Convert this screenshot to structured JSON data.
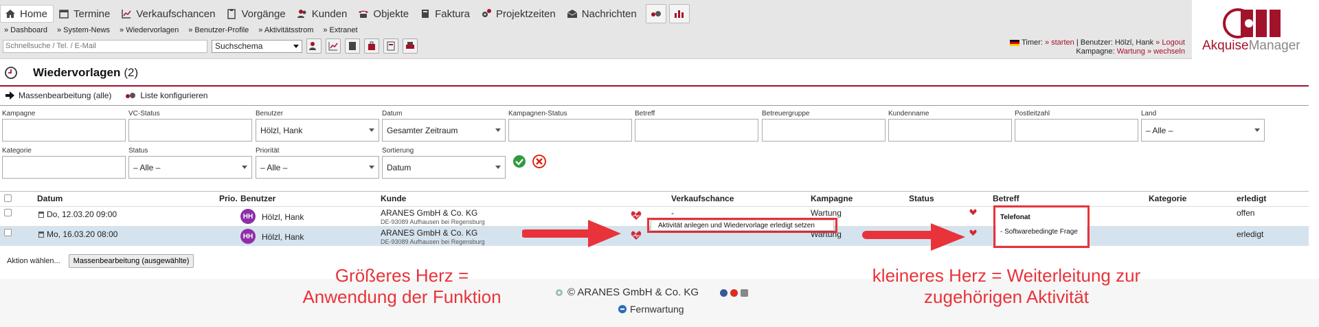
{
  "nav": {
    "items": [
      {
        "label": "Home",
        "icon": "home-icon",
        "active": true
      },
      {
        "label": "Termine",
        "icon": "calendar-icon"
      },
      {
        "label": "Verkaufschancen",
        "icon": "chart-line-icon"
      },
      {
        "label": "Vorgänge",
        "icon": "clipboard-icon"
      },
      {
        "label": "Kunden",
        "icon": "users-icon"
      },
      {
        "label": "Objekte",
        "icon": "phone-icon"
      },
      {
        "label": "Faktura",
        "icon": "book-icon"
      },
      {
        "label": "Projektzeiten",
        "icon": "gears-icon"
      },
      {
        "label": "Nachrichten",
        "icon": "envelope-icon"
      }
    ]
  },
  "subnav": [
    "» Dashboard",
    "» System-News",
    "» Wiedervorlagen",
    "» Benutzer-Profile",
    "» Aktivitätsstrom",
    "» Extranet"
  ],
  "search": {
    "placeholder": "Schnellsuche / Tel. / E-Mail",
    "schema": "Suchschema"
  },
  "userinfo": {
    "timer_label": "Timer:",
    "timer_link": "» starten",
    "benutzer": "| Benutzer: Hölzl, Hank",
    "logout": "» Logout",
    "kampagne_label": "Kampagne:",
    "kampagne_value": "Wartung",
    "wechseln": "» wechseln"
  },
  "brand": {
    "part1": "Akquise",
    "part2": "Manager"
  },
  "page": {
    "title": "Wiedervorlagen",
    "count": "(2)"
  },
  "actions": {
    "bulk_all": "Massenbearbeitung (alle)",
    "configure": "Liste konfigurieren"
  },
  "filters": {
    "row1": [
      {
        "label": "Kampagne",
        "value": ""
      },
      {
        "label": "VC-Status",
        "value": ""
      },
      {
        "label": "Benutzer",
        "value": "Hölzl, Hank"
      },
      {
        "label": "Datum",
        "value": "Gesamter Zeitraum"
      },
      {
        "label": "Kampagnen-Status",
        "value": ""
      },
      {
        "label": "Betreff",
        "value": ""
      },
      {
        "label": "Betreuergruppe",
        "value": ""
      },
      {
        "label": "Kundenname",
        "value": ""
      },
      {
        "label": "Postleitzahl",
        "value": ""
      },
      {
        "label": "Land",
        "value": "– Alle –"
      }
    ],
    "row2": [
      {
        "label": "Kategorie",
        "value": ""
      },
      {
        "label": "Status",
        "value": "– Alle –"
      },
      {
        "label": "Priorität",
        "value": "– Alle –"
      },
      {
        "label": "Sortierung",
        "value": "Datum"
      }
    ]
  },
  "table": {
    "headers": {
      "datum": "Datum",
      "prio": "Prio.",
      "benutzer": "Benutzer",
      "kunde": "Kunde",
      "verkaufschance": "Verkaufschance",
      "kampagne": "Kampagne",
      "status": "Status",
      "betreff": "Betreff",
      "kategorie": "Kategorie",
      "erledigt": "erledigt"
    },
    "rows": [
      {
        "datum": "Do, 12.03.20 09:00",
        "avatar": "HH",
        "benutzer": "Hölzl, Hank",
        "kunde": "ARANES GmbH & Co. KG",
        "kunde_sub": "DE-93089 Aufhausen bei Regensburg",
        "verkaufschance": "-",
        "kampagne": "Wartung",
        "erledigt": "offen"
      },
      {
        "datum": "Mo, 16.03.20 08:00",
        "avatar": "HH",
        "benutzer": "Hölzl, Hank",
        "kunde": "ARANES GmbH & Co. KG",
        "kunde_sub": "DE-93089 Aufhausen bei Regensburg",
        "verkaufschance": "",
        "kampagne": "Wartung",
        "erledigt": "erledigt"
      }
    ]
  },
  "tooltip1": "Aktivität anlegen und Wiedervorlage erledigt setzen",
  "tooltip2": {
    "title": "Telefonat",
    "body": "- Softwarebedingte Frage"
  },
  "bulk": {
    "label": "Aktion wählen...",
    "button": "Massenbearbeitung (ausgewählte)"
  },
  "annotations": {
    "left_line1": "Größeres Herz =",
    "left_line2": "Anwendung der Funktion",
    "right_line1": "kleineres Herz = Weiterleitung zur",
    "right_line2": "zugehörigen Aktivität"
  },
  "footer": {
    "copyright": "© ARANES GmbH & Co. KG",
    "fernwartung": "Fernwartung"
  },
  "colors": {
    "accent": "#a3122b",
    "annotation": "#e8333a",
    "avatar": "#8e2fa7"
  }
}
